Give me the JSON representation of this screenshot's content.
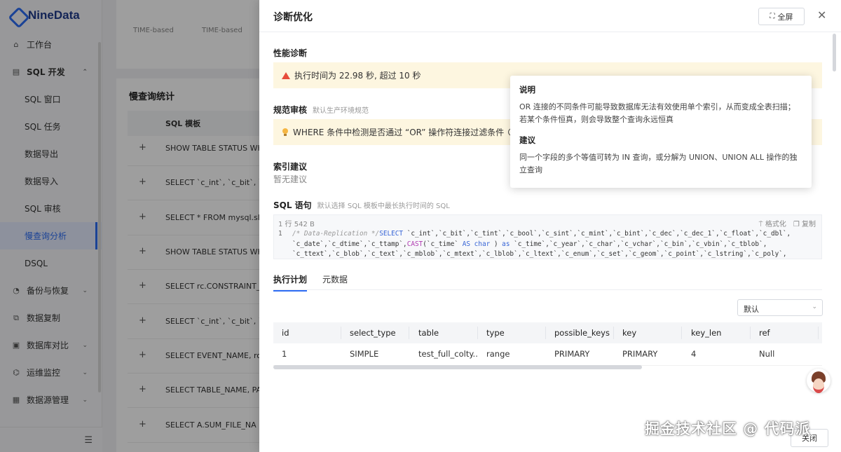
{
  "app": {
    "name": "NineData"
  },
  "sidebar": {
    "items": [
      {
        "label": "工作台",
        "icon": "home-icon",
        "type": "top"
      },
      {
        "label": "SQL 开发",
        "icon": "sql-dev-icon",
        "type": "group",
        "expanded": true
      },
      {
        "label": "SQL 窗口",
        "type": "sub"
      },
      {
        "label": "SQL 任务",
        "type": "sub"
      },
      {
        "label": "数据导出",
        "type": "sub"
      },
      {
        "label": "数据导入",
        "type": "sub"
      },
      {
        "label": "SQL 审核",
        "type": "sub"
      },
      {
        "label": "慢查询分析",
        "type": "sub",
        "active": true
      },
      {
        "label": "DSQL",
        "type": "sub"
      },
      {
        "label": "备份与恢复",
        "icon": "backup-icon",
        "type": "group"
      },
      {
        "label": "数据复制",
        "icon": "replicate-icon",
        "type": "top"
      },
      {
        "label": "数据库对比",
        "icon": "compare-icon",
        "type": "group"
      },
      {
        "label": "运维监控",
        "icon": "monitor-icon",
        "type": "group"
      },
      {
        "label": "数据源管理",
        "icon": "datasource-icon",
        "type": "group"
      }
    ]
  },
  "background": {
    "top_labels": [
      "TIME-based",
      "TIME-based"
    ],
    "slow_query": {
      "title": "慢查询统计",
      "column": "SQL 模板",
      "rows": [
        "SHOW TABLE STATUS WHERE",
        "SELECT `c_int`, `c_bit`, `c",
        "SELECT * FROM mysql.slow_log",
        "SHOW TABLE STATUS WHERE",
        "SELECT rc.CONSTRAINT_NAME",
        "SELECT `c_int`, `c_bit`, `c",
        "SELECT EVENT_NAME, rou",
        "SELECT TABLE_NAME, PA",
        "SELECT A.SUM_FILE_NA"
      ]
    }
  },
  "drawer": {
    "title": "诊断优化",
    "fullscreen_label": "全屏",
    "perf": {
      "label": "性能诊断",
      "alert": "执行时间为 22.98 秒, 超过 10 秒"
    },
    "rule": {
      "label": "规范审核",
      "sub": "默认生产环境规范",
      "alert": "WHERE 条件中检测是否通过 “OR” 操作符连接过滤条件"
    },
    "index": {
      "label": "索引建议",
      "value": "暂无建议"
    },
    "sql": {
      "label": "SQL 语句",
      "sub": "默认选择 SQL 模板中最长执行时间的 SQL",
      "meta": "1 行  542 B",
      "format_label": "格式化",
      "copy_label": "复制",
      "line_number": "1",
      "comment": "/* Data-Replication */",
      "select_kw": "SELECT",
      "line1_rest": " `c_int`,`c_bit`,`c_tint`,`c_bool`,`c_sint`,`c_mint`,`c_bint`,`c_dec`,`c_dec_1`,`c_float`,`c_dbl`,",
      "line2_a": "`c_date`,`c_dtime`,`c_ttamp`,",
      "cast_kw": "CAST",
      "line2_b": "(`c_time` ",
      "as_char": "AS char",
      "line2_c": " ) ",
      "as_kw": "as",
      "line2_d": " `c_time`,`c_year`,`c_char`,`c_vchar`,`c_bin`,`c_vbin`,`c_tblob`,",
      "line3": "`c_ttext`,`c_blob`,`c_text`,`c_mblob`,`c_mtext`,`c_lblob`,`c_ltext`,`c_enum`,`c_set`,`c_geom`,`c_point`,`c_lstring`,`c_poly`,"
    },
    "tabs": [
      {
        "label": "执行计划",
        "active": true
      },
      {
        "label": "元数据",
        "active": false
      }
    ],
    "select_value": "默认",
    "plan": {
      "columns": [
        "id",
        "select_type",
        "table",
        "type",
        "possible_keys",
        "key",
        "key_len",
        "ref"
      ],
      "rows": [
        [
          "1",
          "SIMPLE",
          "test_full_colty...",
          "range",
          "PRIMARY",
          "PRIMARY",
          "4",
          "Null"
        ]
      ]
    },
    "footer_button": "关闭"
  },
  "popover": {
    "desc_title": "说明",
    "desc_text": "OR 连接的不同条件可能导致数据库无法有效使用单个索引，从而变成全表扫描；若某个条件恒真，则会导致整个查询永远恒真",
    "advice_title": "建议",
    "advice_text": "同一个字段的多个等值可转为 IN 查询，或分解为 UNION、UNION ALL 操作的独立查询"
  },
  "watermark": "掘金技术社区 @ 代码派",
  "colors": {
    "accent": "#2d6cf3",
    "warning_bg": "#fdf6e0",
    "danger": "#e74c3c"
  }
}
